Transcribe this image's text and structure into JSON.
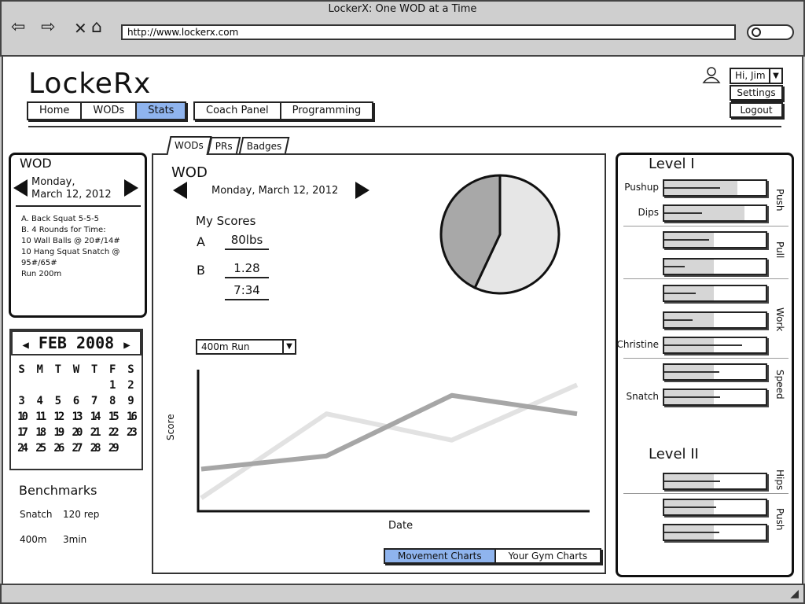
{
  "window": {
    "title": "LockerX: One WOD at a Time",
    "url": "http://www.lockerx.com"
  },
  "app": {
    "logo": "LockeRx"
  },
  "nav": {
    "group1": [
      {
        "label": "Home",
        "active": false
      },
      {
        "label": "WODs",
        "active": false
      },
      {
        "label": "Stats",
        "active": true
      }
    ],
    "group2": [
      {
        "label": "Coach Panel"
      },
      {
        "label": "Programming"
      }
    ]
  },
  "user": {
    "greeting": "Hi, Jim",
    "settings": "Settings",
    "logout": "Logout"
  },
  "wod_panel": {
    "title": "WOD",
    "date_line1": "Monday,",
    "date_line2": "March 12, 2012",
    "items": [
      "A. Back Squat 5-5-5",
      "B. 4 Rounds for Time:",
      "10 Wall Balls @ 20#/14#",
      "10 Hang Squat Snatch @ 95#/65#",
      "Run 200m"
    ]
  },
  "calendar": {
    "month": "FEB 2008",
    "weekdays": [
      "S",
      "M",
      "T",
      "W",
      "T",
      "F",
      "S"
    ],
    "weeks": [
      [
        "",
        "",
        "",
        "",
        "",
        "1",
        "2"
      ],
      [
        "3",
        "4",
        "5",
        "6",
        "7",
        "8",
        "9"
      ],
      [
        "10",
        "11",
        "12",
        "13",
        "14",
        "15",
        "16"
      ],
      [
        "17",
        "18",
        "19",
        "20",
        "21",
        "22",
        "23"
      ],
      [
        "24",
        "25",
        "26",
        "27",
        "28",
        "29",
        ""
      ]
    ]
  },
  "benchmarks": {
    "title": "Benchmarks",
    "rows": [
      {
        "name": "Snatch",
        "value": "120 rep"
      },
      {
        "name": "400m",
        "value": "3min"
      }
    ]
  },
  "tabs": [
    {
      "label": "WODs",
      "active": true
    },
    {
      "label": "PRs",
      "active": false
    },
    {
      "label": "Badges",
      "active": false
    }
  ],
  "center": {
    "title": "WOD",
    "date": "Monday, March 12, 2012",
    "my_scores": "My Scores",
    "scores": [
      {
        "label": "A",
        "values": [
          "80lbs"
        ]
      },
      {
        "label": "B",
        "values": [
          "1.28",
          "7:34"
        ]
      }
    ],
    "dropdown": "400m Run",
    "segments": [
      {
        "label": "Movement Charts",
        "active": true
      },
      {
        "label": "Your Gym Charts",
        "active": false
      }
    ]
  },
  "chart_data": [
    {
      "type": "pie",
      "values": [
        57,
        43
      ],
      "colors": [
        "#e6e6e6",
        "#a8a8a8"
      ]
    },
    {
      "type": "line",
      "xlabel": "Date",
      "ylabel": "Score",
      "x": [
        0,
        1,
        2,
        3
      ],
      "series": [
        {
          "values": [
            0.5,
            3.7,
            2.7,
            4.8
          ],
          "color": "#e2e2e2"
        },
        {
          "values": [
            1.6,
            2.1,
            4.4,
            3.7
          ],
          "color": "#a6a6a6"
        }
      ],
      "ylim": [
        0,
        5.2
      ],
      "xlim": [
        0,
        3
      ],
      "grid": false
    }
  ],
  "levels": [
    {
      "title": "Level I",
      "groups": [
        {
          "label": "Push",
          "bars": [
            {
              "name": "Pushup",
              "fill": 0.72,
              "line": 0.55
            },
            {
              "name": "Dips",
              "fill": 0.79,
              "line": 0.37
            }
          ]
        },
        {
          "label": "Pull",
          "bars": [
            {
              "name": "",
              "fill": 0.49,
              "line": 0.44
            },
            {
              "name": "",
              "fill": 0.49,
              "line": 0.2
            }
          ]
        },
        {
          "label": "Work",
          "bars": [
            {
              "name": "",
              "fill": 0.49,
              "line": 0.31
            },
            {
              "name": "",
              "fill": 0.49,
              "line": 0.28
            },
            {
              "name": "Christine",
              "fill": 0.49,
              "line": 0.77
            }
          ]
        },
        {
          "label": "Speed",
          "bars": [
            {
              "name": "",
              "fill": 0.49,
              "line": 0.54
            },
            {
              "name": "Snatch",
              "fill": 0.49,
              "line": 0.55
            }
          ]
        }
      ]
    },
    {
      "title": "Level II",
      "groups": [
        {
          "label": "Hips",
          "bars": [
            {
              "name": "",
              "fill": 0.49,
              "line": 0.55
            }
          ]
        },
        {
          "label": "Push",
          "bars": [
            {
              "name": "",
              "fill": 0.49,
              "line": 0.51
            },
            {
              "name": "",
              "fill": 0.49,
              "line": 0.54
            }
          ]
        }
      ]
    }
  ]
}
